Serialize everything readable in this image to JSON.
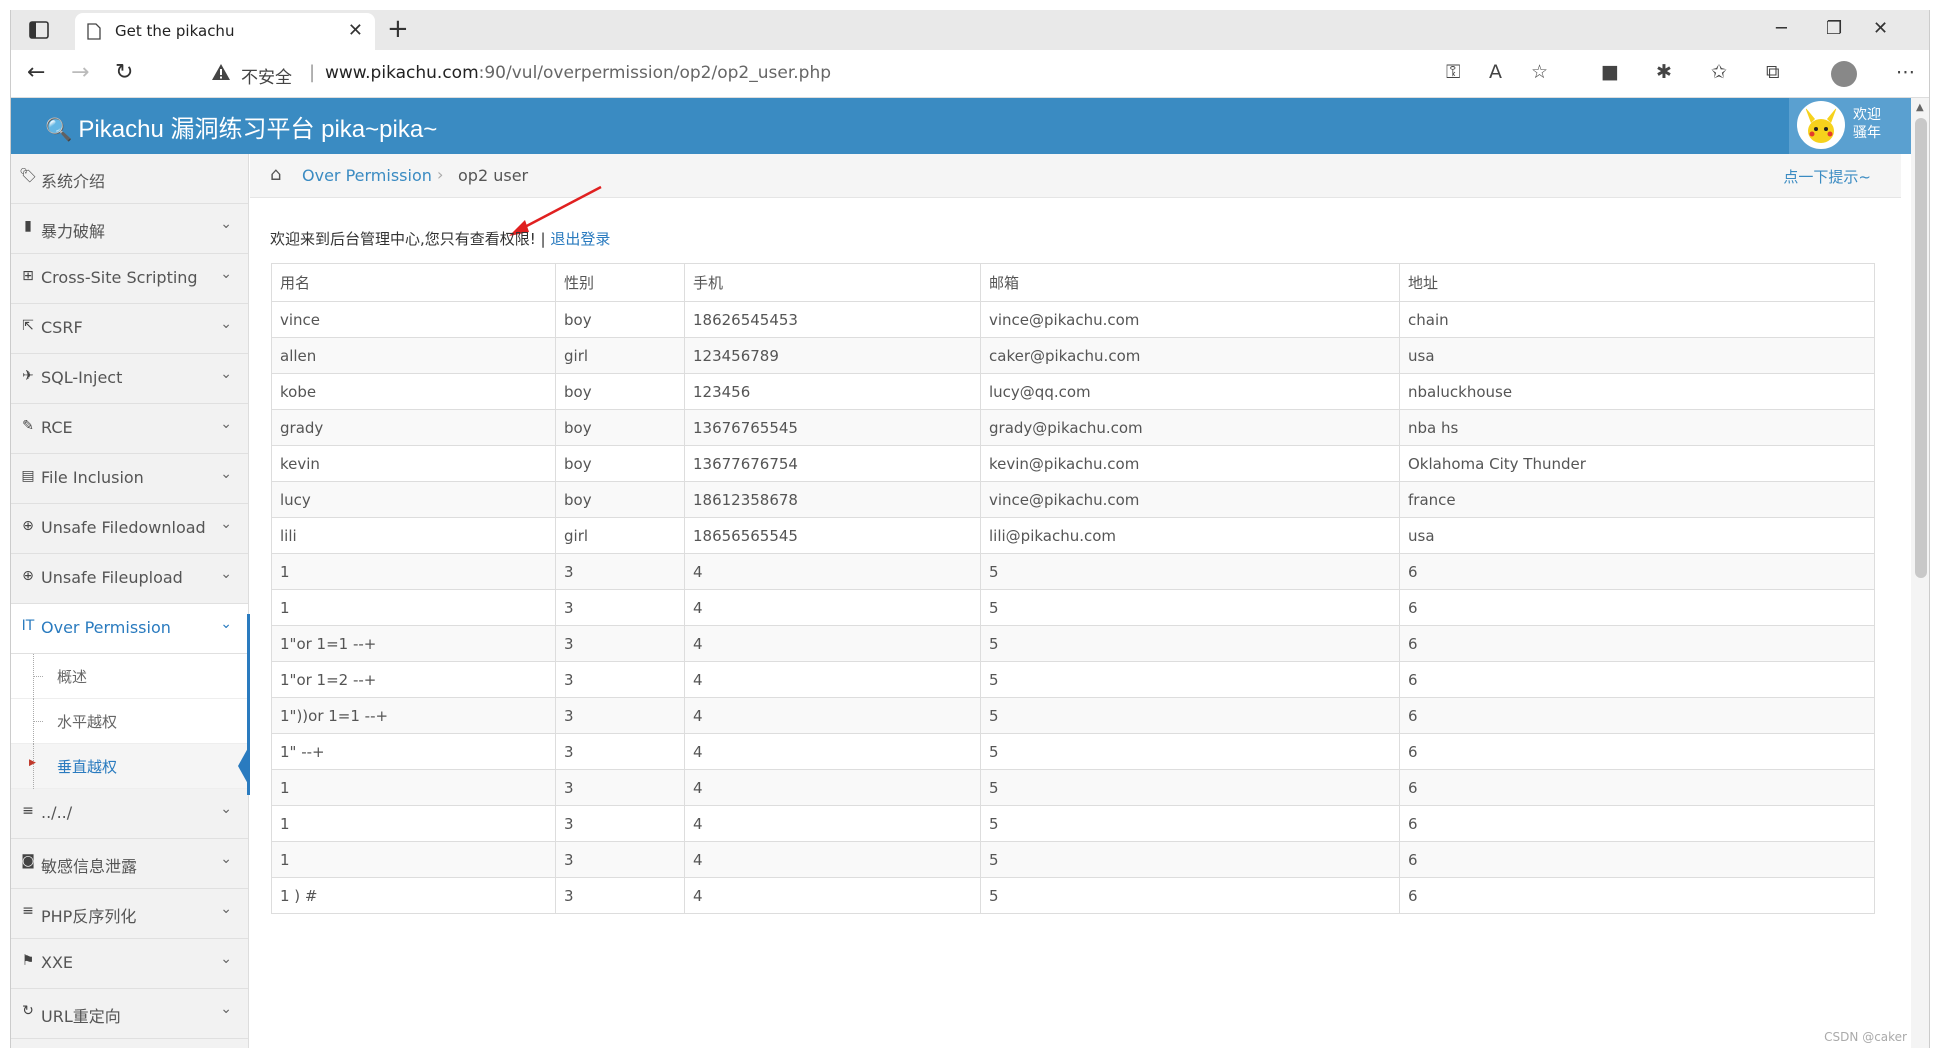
{
  "browser": {
    "tab_title": "Get the pikachu",
    "security_label": "不安全",
    "url_host": "www.pikachu.com",
    "url_rest": ":90/vul/overpermission/op2/op2_user.php"
  },
  "site": {
    "title": "Pikachu 漏洞练习平台 pika~pika~",
    "welcome_line1": "欢迎",
    "welcome_line2": "骚年"
  },
  "sidebar": {
    "items": [
      {
        "label": "系统介绍",
        "icon": "tags-icon"
      },
      {
        "label": "暴力破解",
        "icon": "lock-icon"
      },
      {
        "label": "Cross-Site Scripting",
        "icon": "sitemap-icon"
      },
      {
        "label": "CSRF",
        "icon": "share-icon"
      },
      {
        "label": "SQL-Inject",
        "icon": "plane-icon"
      },
      {
        "label": "RCE",
        "icon": "pencil-icon"
      },
      {
        "label": "File Inclusion",
        "icon": "file-icon"
      },
      {
        "label": "Unsafe Filedownload",
        "icon": "download-icon"
      },
      {
        "label": "Unsafe Fileupload",
        "icon": "upload-icon"
      },
      {
        "label": "Over Permission",
        "icon": "text-height-icon"
      }
    ],
    "sub_items": [
      "概述",
      "水平越权",
      "垂直越权"
    ],
    "items_after": [
      {
        "label": "../../",
        "icon": "list-icon"
      },
      {
        "label": "敏感信息泄露",
        "icon": "camera-icon"
      },
      {
        "label": "PHP反序列化",
        "icon": "align-icon"
      },
      {
        "label": "XXE",
        "icon": "flag-icon"
      },
      {
        "label": "URL重定向",
        "icon": "refresh-icon"
      }
    ]
  },
  "breadcrumb": {
    "link": "Over Permission",
    "current": "op2 user",
    "hint": "点一下提示~"
  },
  "welcome": {
    "text": "欢迎来到后台管理中心,您只有查看权限! | ",
    "logout": "退出登录"
  },
  "table": {
    "headers": [
      "用名",
      "性别",
      "手机",
      "邮箱",
      "地址"
    ],
    "rows": [
      [
        "vince",
        "boy",
        "18626545453",
        "vince@pikachu.com",
        "chain"
      ],
      [
        "allen",
        "girl",
        "123456789",
        "caker@pikachu.com",
        "usa"
      ],
      [
        "kobe",
        "boy",
        "123456",
        "lucy@qq.com",
        "nbaluckhouse"
      ],
      [
        "grady",
        "boy",
        "13676765545",
        "grady@pikachu.com",
        "nba hs"
      ],
      [
        "kevin",
        "boy",
        "13677676754",
        "kevin@pikachu.com",
        "Oklahoma City Thunder"
      ],
      [
        "lucy",
        "boy",
        "18612358678",
        "vince@pikachu.com",
        "france"
      ],
      [
        "lili",
        "girl",
        "18656565545",
        "lili@pikachu.com",
        "usa"
      ],
      [
        "1",
        "3",
        "4",
        "5",
        "6"
      ],
      [
        "1",
        "3",
        "4",
        "5",
        "6"
      ],
      [
        "1\"or 1=1 --+",
        "3",
        "4",
        "5",
        "6"
      ],
      [
        "1\"or 1=2 --+",
        "3",
        "4",
        "5",
        "6"
      ],
      [
        "1\"))or 1=1 --+",
        "3",
        "4",
        "5",
        "6"
      ],
      [
        "1\" --+",
        "3",
        "4",
        "5",
        "6"
      ],
      [
        "1",
        "3",
        "4",
        "5",
        "6"
      ],
      [
        "1",
        "3",
        "4",
        "5",
        "6"
      ],
      [
        "1",
        "3",
        "4",
        "5",
        "6"
      ],
      [
        "1 ) #",
        "3",
        "4",
        "5",
        "6"
      ]
    ]
  },
  "watermark": "CSDN @caker"
}
